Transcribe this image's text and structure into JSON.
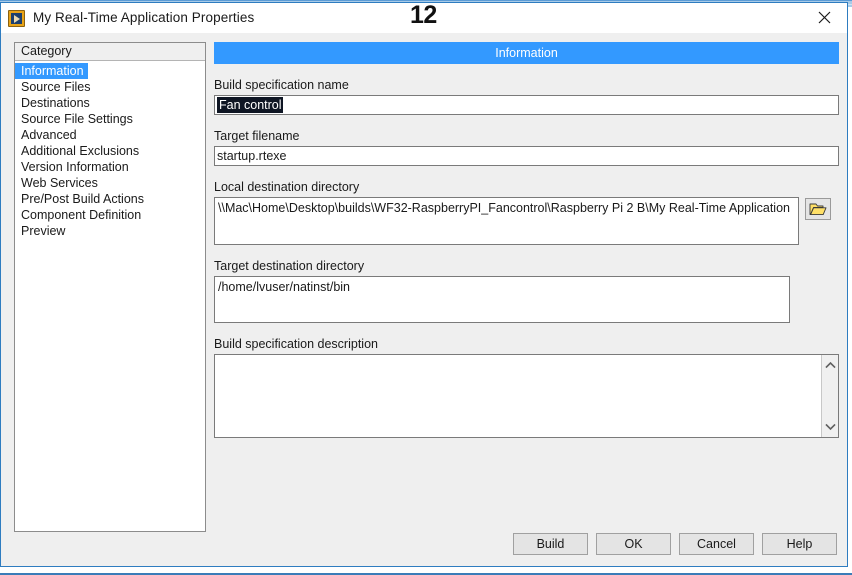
{
  "window": {
    "title": "My Real-Time Application Properties",
    "icon": "labview-vi-icon",
    "close_label": "✕"
  },
  "annotation": {
    "number": "12"
  },
  "colors": {
    "accent_blue": "#3399ff",
    "window_border_blue": "#2e7cc0",
    "dialog_bg": "#efefef",
    "selection_navy": "#0f1624"
  },
  "sidebar": {
    "header": "Category",
    "items": [
      {
        "label": "Information",
        "selected": true
      },
      {
        "label": "Source Files",
        "selected": false
      },
      {
        "label": "Destinations",
        "selected": false
      },
      {
        "label": "Source File Settings",
        "selected": false
      },
      {
        "label": "Advanced",
        "selected": false
      },
      {
        "label": "Additional Exclusions",
        "selected": false
      },
      {
        "label": "Version Information",
        "selected": false
      },
      {
        "label": "Web Services",
        "selected": false
      },
      {
        "label": "Pre/Post Build Actions",
        "selected": false
      },
      {
        "label": "Component Definition",
        "selected": false
      },
      {
        "label": "Preview",
        "selected": false
      }
    ]
  },
  "main": {
    "banner": "Information",
    "fields": {
      "build_spec_name": {
        "label": "Build specification name",
        "value": "Fan control",
        "selected": true
      },
      "target_filename": {
        "label": "Target filename",
        "value": "startup.rtexe"
      },
      "local_destination_directory": {
        "label": "Local destination directory",
        "value": "\\\\Mac\\Home\\Desktop\\builds\\WF32-RaspberryPI_Fancontrol\\Raspberry Pi 2 B\\My Real-Time Application",
        "browse_icon": "open-folder-icon"
      },
      "target_destination_directory": {
        "label": "Target destination directory",
        "value": "/home/lvuser/natinst/bin"
      },
      "build_spec_description": {
        "label": "Build specification description",
        "value": ""
      }
    }
  },
  "footer": {
    "buttons": [
      {
        "label": "Build"
      },
      {
        "label": "OK"
      },
      {
        "label": "Cancel"
      },
      {
        "label": "Help"
      }
    ]
  }
}
